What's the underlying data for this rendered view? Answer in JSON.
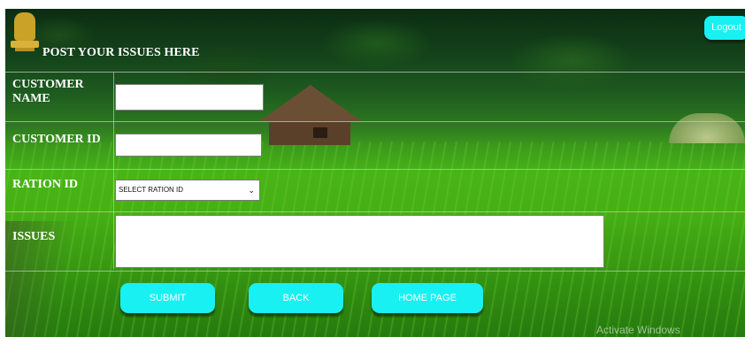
{
  "header": {
    "title": "POST YOUR ISSUES HERE",
    "logout_label": "Logout"
  },
  "form": {
    "customer_name_label_line1": "CUSTOMER",
    "customer_name_label_line2": "NAME",
    "customer_name_value": "",
    "customer_id_label": "CUSTOMER ID",
    "customer_id_value": "",
    "ration_id_label": "RATION ID",
    "ration_id_selected": "SELECT RATION ID",
    "issues_label": "ISSUES",
    "issues_value": ""
  },
  "buttons": {
    "submit": "SUBMIT",
    "back": "BACK",
    "home": "HOME PAGE"
  },
  "watermark": "Activate Windows",
  "icons": {
    "emblem": "national-emblem-icon",
    "dropdown": "chevron-down-icon"
  },
  "colors": {
    "button": "#19f0f2",
    "text": "#ffffff"
  }
}
